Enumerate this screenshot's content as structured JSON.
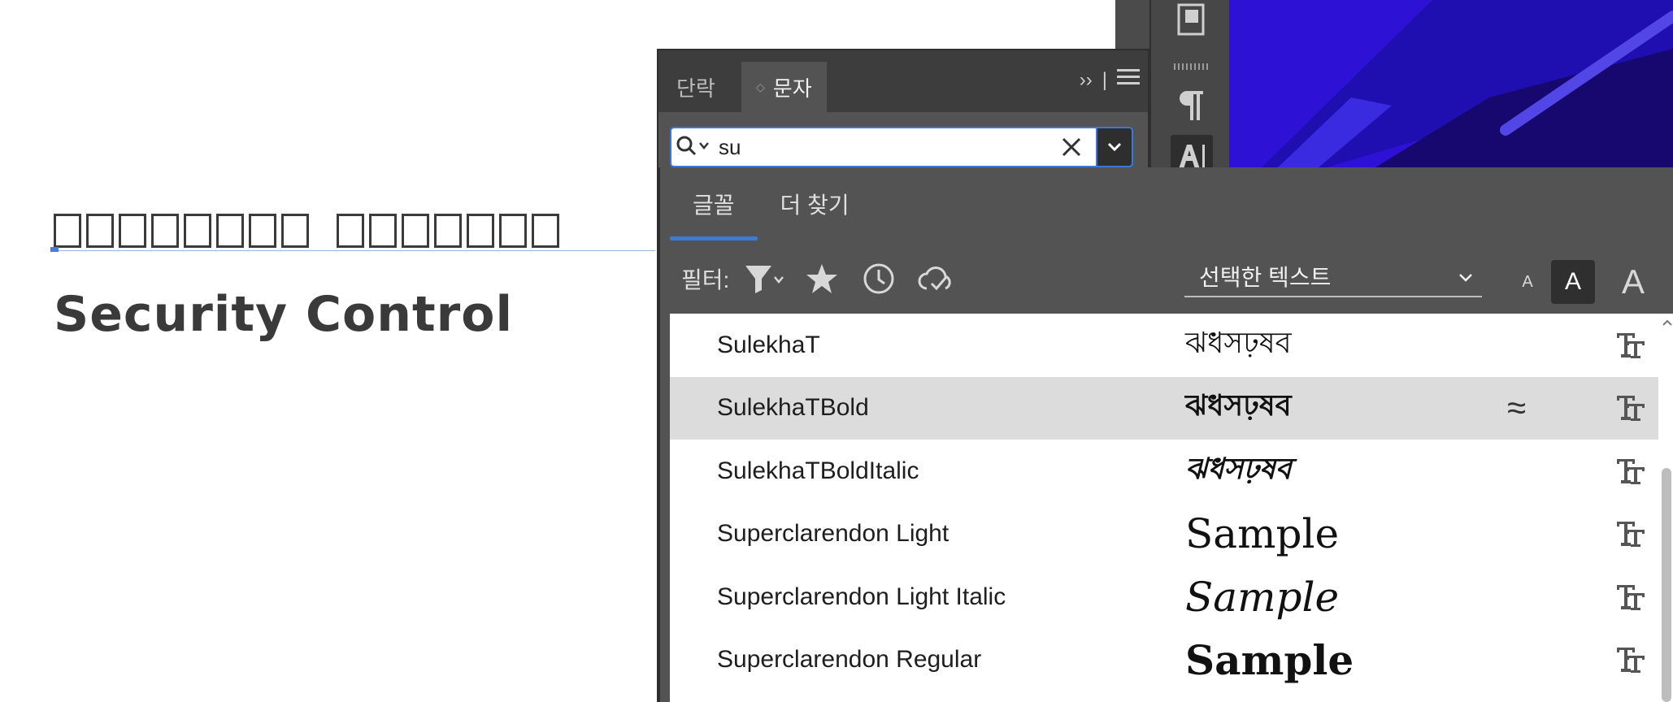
{
  "canvas": {
    "heading": "Security Control"
  },
  "char_panel": {
    "tabs": [
      {
        "label": "단락"
      },
      {
        "label": "문자"
      }
    ],
    "controls": {
      "collapse": "››",
      "divider": "|"
    },
    "search": {
      "value": "su",
      "placeholder": ""
    }
  },
  "font_dropdown": {
    "tabs": [
      {
        "label": "글꼴"
      },
      {
        "label": "더 찾기"
      }
    ],
    "filter_label": "필터:",
    "filter_icons": [
      "filter-icon",
      "star-icon",
      "clock-icon",
      "cloud-check-icon"
    ],
    "sample_text_select": "선택한 텍스트",
    "size_buttons": [
      "A",
      "A",
      "A"
    ],
    "fonts": [
      {
        "name": "SulekhaT",
        "sample": "ঝধসঢ়ষব",
        "style": "regular",
        "selected": false,
        "similar": ""
      },
      {
        "name": "SulekhaTBold",
        "sample": "ঝধসঢ়ষব",
        "style": "bold",
        "selected": true,
        "similar": "≈"
      },
      {
        "name": "SulekhaTBoldItalic",
        "sample": "ঝধসঢ়ষব",
        "style": "bolditalic",
        "selected": false,
        "similar": ""
      },
      {
        "name": "Superclarendon Light",
        "sample": "Sample",
        "style": "serif-light",
        "selected": false,
        "similar": ""
      },
      {
        "name": "Superclarendon Light Italic",
        "sample": "Sample",
        "style": "serif-italic",
        "selected": false,
        "similar": ""
      },
      {
        "name": "Superclarendon Regular",
        "sample": "Sample",
        "style": "serif-bold",
        "selected": false,
        "similar": ""
      }
    ]
  },
  "colors": {
    "panel_bg": "#535353",
    "accent_blue": "#3b7ad6",
    "art_purple": "#2d12d6"
  }
}
